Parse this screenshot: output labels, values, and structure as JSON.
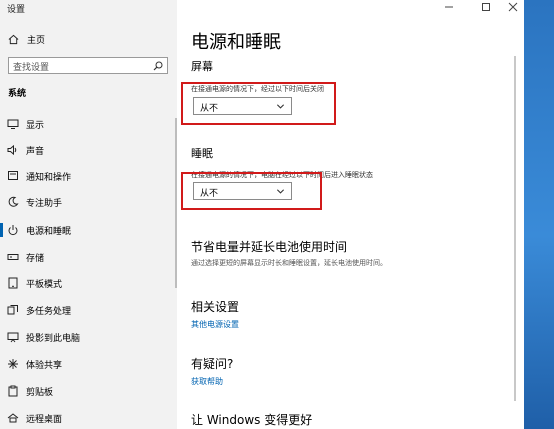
{
  "window": {
    "title": "设置"
  },
  "sidebar": {
    "home_label": "主页",
    "search_placeholder": "查找设置",
    "category": "系统",
    "items": [
      {
        "label": "显示",
        "icon": "monitor-icon"
      },
      {
        "label": "声音",
        "icon": "speaker-icon"
      },
      {
        "label": "通知和操作",
        "icon": "notification-icon"
      },
      {
        "label": "专注助手",
        "icon": "moon-icon"
      },
      {
        "label": "电源和睡眠",
        "icon": "power-icon",
        "active": true
      },
      {
        "label": "存储",
        "icon": "storage-icon"
      },
      {
        "label": "平板模式",
        "icon": "tablet-icon"
      },
      {
        "label": "多任务处理",
        "icon": "multitask-icon"
      },
      {
        "label": "投影到此电脑",
        "icon": "projector-icon"
      },
      {
        "label": "体验共享",
        "icon": "share-icon"
      },
      {
        "label": "剪贴板",
        "icon": "clipboard-icon"
      },
      {
        "label": "远程桌面",
        "icon": "remote-desktop-icon"
      }
    ]
  },
  "main": {
    "title": "电源和睡眠",
    "screen": {
      "heading": "屏幕",
      "label": "在接通电源的情况下，经过以下时间后关闭",
      "value": "从不"
    },
    "sleep": {
      "heading": "睡眠",
      "label": "在接通电源的情况下，电脑在经过以下时间后进入睡眠状态",
      "value": "从不"
    },
    "battery": {
      "heading": "节省电量并延长电池使用时间",
      "description": "通过选择更短的屏幕显示时长和睡眠设置，延长电池使用时间。"
    },
    "related": {
      "heading": "相关设置",
      "link": "其他电源设置"
    },
    "help": {
      "heading": "有疑问?",
      "link": "获取帮助"
    },
    "bottom_heading": "让 Windows 变得更好"
  },
  "colors": {
    "accent": "#0063b1",
    "highlight": "#d11a1a",
    "sidebar_bg": "#f2f2f2"
  }
}
